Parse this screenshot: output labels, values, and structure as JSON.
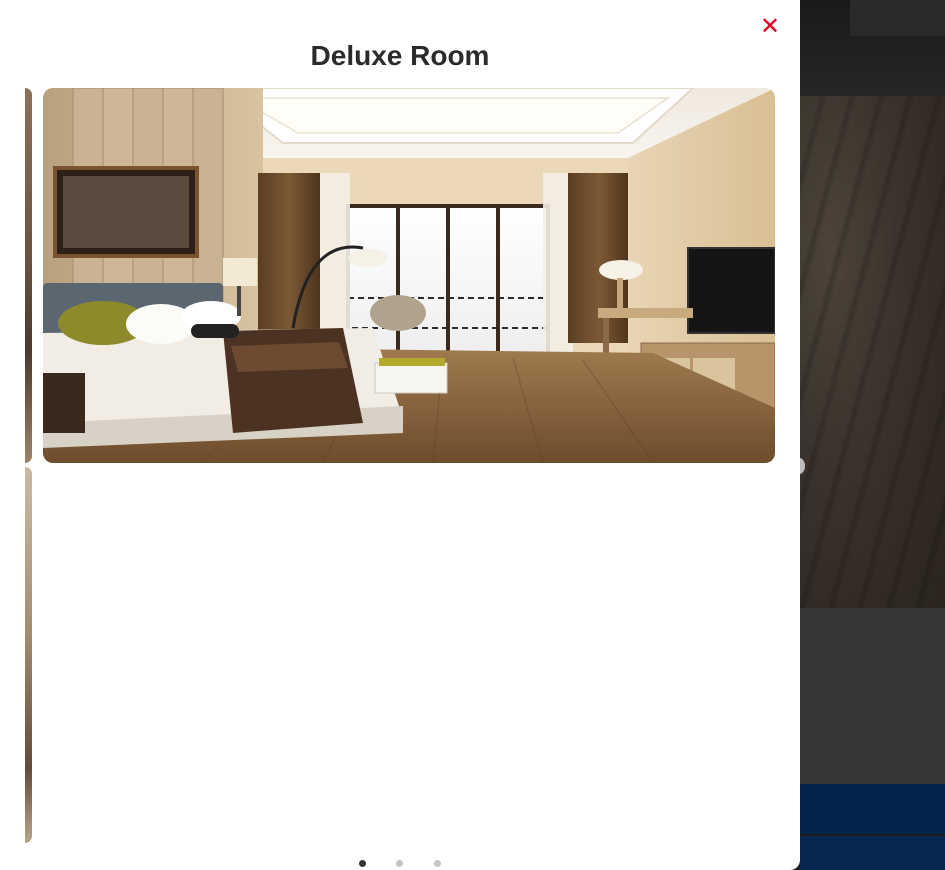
{
  "modal": {
    "title": "Deluxe Room",
    "close_symbol": "✕"
  },
  "carousel": {
    "slides": [
      {
        "image": "deluxe-room-photo"
      },
      {
        "image": ""
      },
      {
        "image": ""
      }
    ],
    "active_index": 0,
    "dot_count": 3
  },
  "colors": {
    "close_icon": "#e0001b",
    "title": "#2b2b2b",
    "dot_active": "#333333",
    "dot_inactive": "#c4c4c4",
    "backdrop_navy": "#03244a"
  }
}
